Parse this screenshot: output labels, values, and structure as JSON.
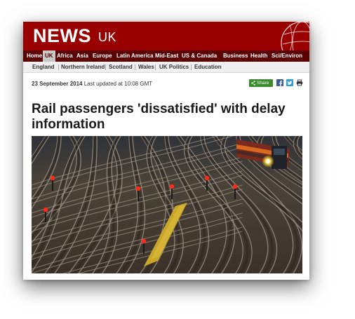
{
  "masthead": {
    "logo": "NEWS",
    "edition": "UK",
    "brand_color": "#990000",
    "nav_color": "#5a0000"
  },
  "nav": {
    "items": [
      {
        "label": "Home",
        "active": false
      },
      {
        "label": "UK",
        "active": true
      },
      {
        "label": "Africa",
        "active": false
      },
      {
        "label": "Asia",
        "active": false
      },
      {
        "label": "Europe",
        "active": false
      },
      {
        "label": "Latin America",
        "active": false
      },
      {
        "label": "Mid-East",
        "active": false
      },
      {
        "label": "US & Canada",
        "active": false
      },
      {
        "label": "Business",
        "active": false
      },
      {
        "label": "Health",
        "active": false
      },
      {
        "label": "Sci/Environ",
        "active": false
      }
    ]
  },
  "subnav": {
    "items": [
      "England",
      "Northern Ireland",
      "Scotland",
      "Wales",
      "UK Politics",
      "Education"
    ]
  },
  "article": {
    "date": "23 September 2014",
    "updated": "Last updated at 10:08 GMT",
    "share_label": "Share",
    "share_color": "#3a8c2e",
    "social_icons": [
      "facebook-icon",
      "twitter-icon",
      "print-icon"
    ],
    "headline": "Rail passengers 'dissatisfied' with delay information",
    "image": "railway-tracks-photo"
  }
}
